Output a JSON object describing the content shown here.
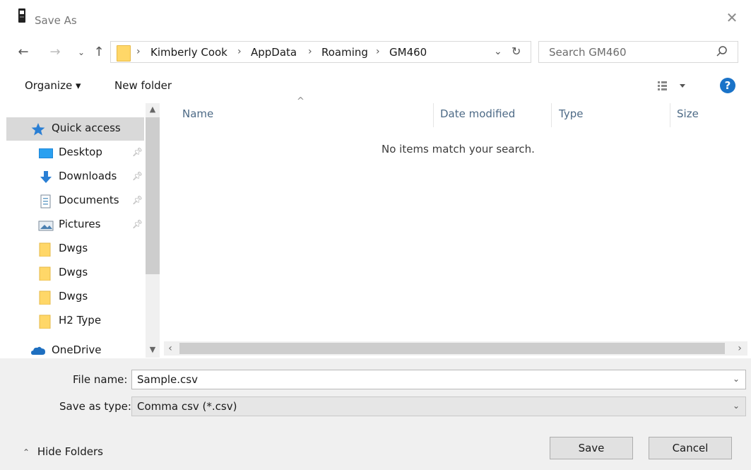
{
  "window": {
    "title": "Save As",
    "close_icon": "close-icon"
  },
  "nav": {
    "back_icon": "arrow-left-icon",
    "forward_icon": "arrow-right-icon",
    "recent_icon": "chevron-down-icon",
    "up_icon": "arrow-up-icon",
    "breadcrumbs": [
      "Kimberly Cook",
      "AppData",
      "Roaming",
      "GM460"
    ],
    "search_placeholder": "Search GM460"
  },
  "toolbar": {
    "organize_label": "Organize ▾",
    "new_folder_label": "New folder",
    "help_label": "?"
  },
  "sidebar": {
    "items": [
      {
        "label": "Quick access",
        "icon": "star-icon",
        "pinned": false
      },
      {
        "label": "Desktop",
        "icon": "desktop-icon",
        "pinned": true
      },
      {
        "label": "Downloads",
        "icon": "download-icon",
        "pinned": true
      },
      {
        "label": "Documents",
        "icon": "document-icon",
        "pinned": true
      },
      {
        "label": "Pictures",
        "icon": "pictures-icon",
        "pinned": true
      },
      {
        "label": "Dwgs",
        "icon": "folder-icon",
        "pinned": false
      },
      {
        "label": "Dwgs",
        "icon": "folder-icon",
        "pinned": false
      },
      {
        "label": "Dwgs",
        "icon": "folder-icon",
        "pinned": false
      },
      {
        "label": "H2 Type",
        "icon": "folder-icon",
        "pinned": false
      },
      {
        "label": "OneDrive",
        "icon": "cloud-icon",
        "pinned": false
      }
    ]
  },
  "content": {
    "columns": [
      "Name",
      "Date modified",
      "Type",
      "Size"
    ],
    "empty_message": "No items match your search."
  },
  "form": {
    "file_name_label": "File name:",
    "file_name_value": "Sample.csv",
    "save_type_label": "Save as type:",
    "save_type_value": "Comma csv (*.csv)",
    "save_label": "Save",
    "cancel_label": "Cancel",
    "hide_folders_label": "Hide Folders"
  },
  "colors": {
    "accent": "#1a73c8",
    "folder": "#ffd768",
    "selected": "#d9d9d9",
    "panel": "#f0f0f0"
  }
}
